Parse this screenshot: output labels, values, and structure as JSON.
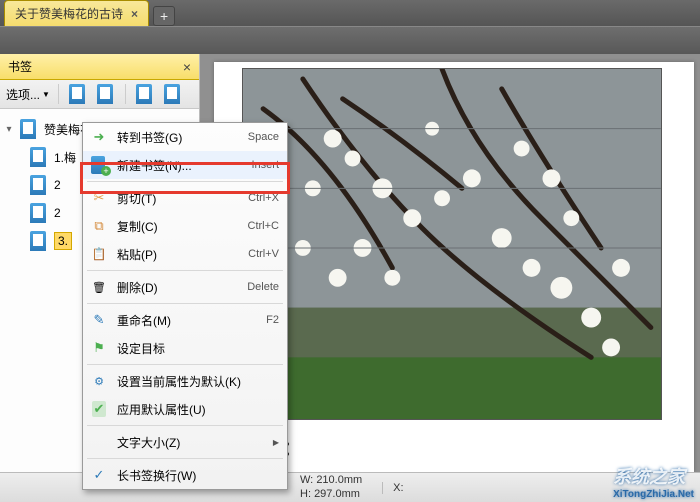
{
  "tab": {
    "title": "关于赞美梅花的古诗"
  },
  "sidebar": {
    "title": "书签",
    "options_label": "选项...",
    "root": "赞美梅花的古诗",
    "items": [
      "1.梅",
      "2",
      "2",
      "3."
    ]
  },
  "contextmenu": {
    "items": [
      {
        "icon": "go",
        "label": "转到书签(G)",
        "shortcut": "Space"
      },
      {
        "icon": "new",
        "label": "新建书签(N)...",
        "shortcut": "Insert"
      },
      {
        "icon": "cut",
        "label": "剪切(T)",
        "shortcut": "Ctrl+X"
      },
      {
        "icon": "copy",
        "label": "复制(C)",
        "shortcut": "Ctrl+C"
      },
      {
        "icon": "paste",
        "label": "粘贴(P)",
        "shortcut": "Ctrl+V"
      },
      {
        "icon": "del",
        "label": "删除(D)",
        "shortcut": "Delete"
      },
      {
        "icon": "rename",
        "label": "重命名(M)",
        "shortcut": "F2"
      },
      {
        "icon": "target",
        "label": "设定目标",
        "shortcut": ""
      },
      {
        "icon": "prop",
        "label": "设置当前属性为默认(K)",
        "shortcut": ""
      },
      {
        "icon": "apply",
        "label": "应用默认属性(U)",
        "shortcut": ""
      },
      {
        "icon": "",
        "label": "文字大小(Z)",
        "shortcut": "",
        "submenu": true
      },
      {
        "icon": "",
        "label": "长书签换行(W)",
        "shortcut": "",
        "checked": true
      }
    ]
  },
  "document": {
    "annotation_label": "注释：",
    "status": {
      "w_label": "W:",
      "w_value": "210.0mm",
      "h_label": "H:",
      "h_value": "297.0mm",
      "x_label": "X:"
    }
  },
  "watermark": {
    "main": "系统之家",
    "sub": "XiTongZhiJia.Net"
  }
}
